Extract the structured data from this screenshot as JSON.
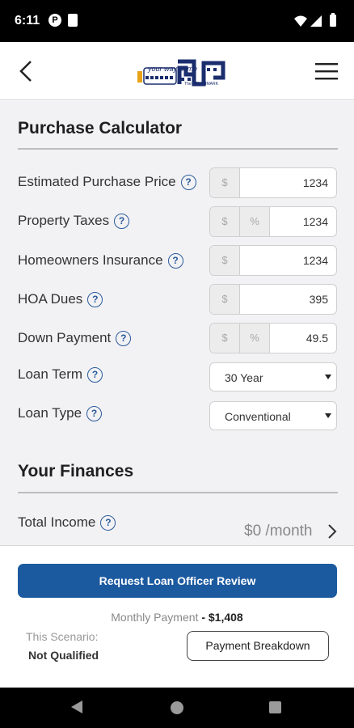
{
  "status_bar": {
    "time": "6:11",
    "icon_p": "P"
  },
  "header": {
    "back_icon": "back-chevron-icon",
    "menu_icon": "hamburger-menu-icon",
    "logo_text": "your way home",
    "logo_subtext": "The BENCHMARK"
  },
  "calculator": {
    "title": "Purchase Calculator",
    "fields": [
      {
        "label": "Estimated Purchase Price",
        "prefix": "$",
        "value": "1234"
      },
      {
        "label": "Property Taxes",
        "prefix": "$",
        "suffix_mode": "%",
        "value": "1234"
      },
      {
        "label": "Homeowners Insurance",
        "prefix": "$",
        "value": "1234"
      },
      {
        "label": "HOA Dues",
        "prefix": "$",
        "value": "395"
      },
      {
        "label": "Down Payment",
        "prefix": "$",
        "suffix_mode": "%",
        "value": "49.5"
      }
    ],
    "loan_term": {
      "label": "Loan Term",
      "selected": "30 Year"
    },
    "loan_type": {
      "label": "Loan Type",
      "selected": "Conventional"
    },
    "help_glyph": "?"
  },
  "finances": {
    "title": "Your Finances",
    "total_income": {
      "label": "Total Income",
      "value": "$0 /month"
    }
  },
  "footer": {
    "request_button": "Request Loan Officer Review",
    "monthly_label": "Monthly Payment",
    "monthly_separator": " - ",
    "monthly_amount": "$1,408",
    "scenario_label": "This Scenario:",
    "scenario_value": "Not Qualified",
    "breakdown_button": "Payment Breakdown"
  },
  "colors": {
    "primary": "#1c5aa0",
    "help": "#2a5a9a",
    "content_bg": "#f2f2f5"
  }
}
